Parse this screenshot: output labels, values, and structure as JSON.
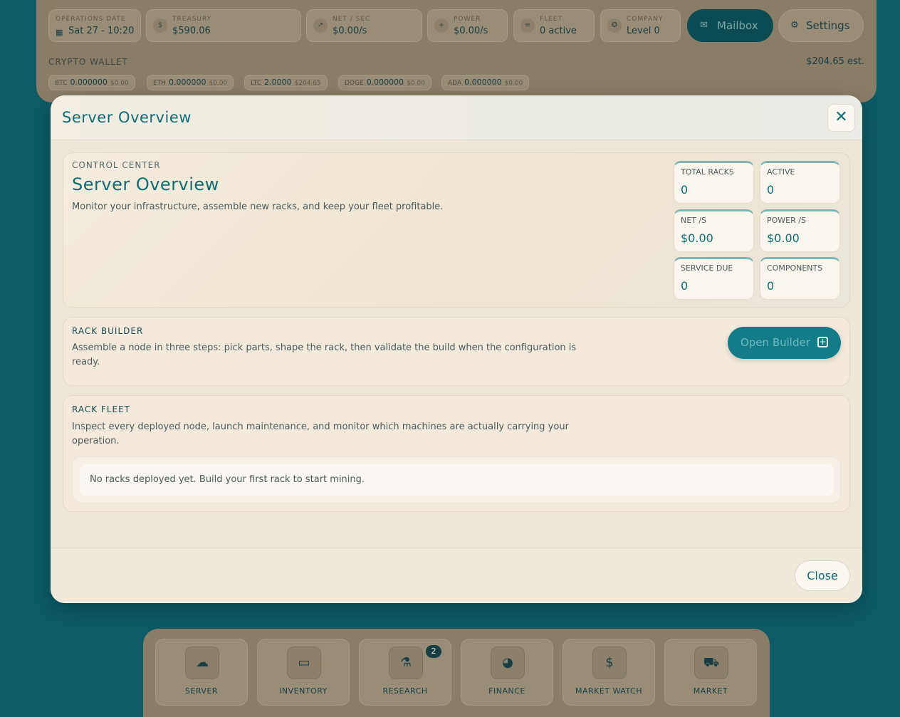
{
  "topbar": {
    "operations_date": {
      "label": "OPERATIONS DATE",
      "value": "Sat 27 - 10:20"
    },
    "treasury": {
      "label": "TREASURY",
      "value": "$590.06"
    },
    "net_sec": {
      "label": "NET / SEC",
      "value": "$0.00/s"
    },
    "power": {
      "label": "POWER",
      "value": "$0.00/s"
    },
    "fleet": {
      "label": "FLEET",
      "value": "0 active"
    },
    "company": {
      "label": "COMPANY",
      "value": "Level 0"
    },
    "mailbox_label": "Mailbox",
    "settings_label": "Settings"
  },
  "wallet": {
    "title": "CRYPTO WALLET",
    "estimate": "$204.65 est.",
    "coins": [
      {
        "symbol": "BTC",
        "amount": "0.000000",
        "fiat": "$0.00"
      },
      {
        "symbol": "ETH",
        "amount": "0.000000",
        "fiat": "$0.00"
      },
      {
        "symbol": "LTC",
        "amount": "2.0000",
        "fiat": "$204.65"
      },
      {
        "symbol": "DOGE",
        "amount": "0.000000",
        "fiat": "$0.00"
      },
      {
        "symbol": "ADA",
        "amount": "0.000000",
        "fiat": "$0.00"
      }
    ]
  },
  "modal": {
    "title": "Server Overview",
    "close_label": "Close",
    "control": {
      "eyebrow": "CONTROL CENTER",
      "title": "Server Overview",
      "description": "Monitor your infrastructure, assemble new racks, and keep your fleet profitable.",
      "metrics": [
        {
          "label": "Total Racks",
          "value": "0"
        },
        {
          "label": "Active",
          "value": "0"
        },
        {
          "label": "Net /s",
          "value": "$0.00"
        },
        {
          "label": "Power /s",
          "value": "$0.00"
        },
        {
          "label": "Service Due",
          "value": "0"
        },
        {
          "label": "Components",
          "value": "0"
        }
      ]
    },
    "builder": {
      "title": "RACK BUILDER",
      "description": "Assemble a node in three steps: pick parts, shape the rack, then validate the build when the configuration is ready.",
      "button_label": "Open Builder"
    },
    "fleet": {
      "title": "RACK FLEET",
      "description": "Inspect every deployed node, launch maintenance, and monitor which machines are actually carrying your operation.",
      "empty_message": "No racks deployed yet. Build your first rack to start mining."
    }
  },
  "nav": {
    "items": [
      {
        "label": "SERVER",
        "icon": "server-icon"
      },
      {
        "label": "INVENTORY",
        "icon": "box-icon"
      },
      {
        "label": "RESEARCH",
        "icon": "flask-icon"
      },
      {
        "label": "FINANCE",
        "icon": "pie-chart-icon"
      },
      {
        "label": "MARKET WATCH",
        "icon": "dollar-icon"
      },
      {
        "label": "MARKET",
        "icon": "cart-icon"
      }
    ],
    "research_badge": "2"
  },
  "colors": {
    "accent": "#0d6d74",
    "backdrop": "#0c5b66",
    "modal_bg": "#efe7d9"
  }
}
